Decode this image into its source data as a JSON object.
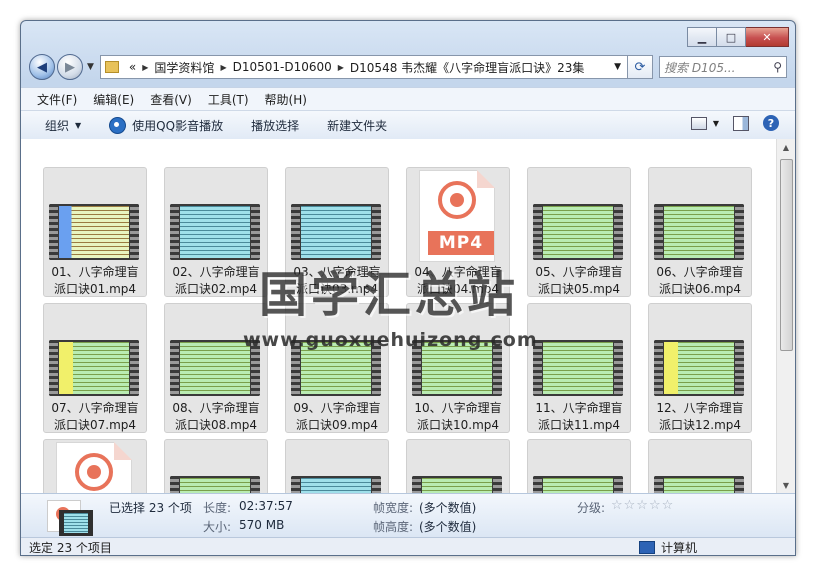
{
  "window": {
    "caption_min": "▁",
    "caption_max": "□",
    "caption_close": "✕"
  },
  "nav": {
    "back_glyph": "◀",
    "fwd_glyph": "▶",
    "overflow": "«",
    "breadcrumbs": [
      "国学资料馆",
      "D10501-D10600",
      "D10548 韦杰耀《八字命理盲派口诀》23集"
    ],
    "search_placeholder": "搜索 D105..."
  },
  "menu": [
    "文件(F)",
    "编辑(E)",
    "查看(V)",
    "工具(T)",
    "帮助(H)"
  ],
  "toolbar": {
    "organize": "组织",
    "play_qq": "使用QQ影音播放",
    "play_selection": "播放选择",
    "new_folder": "新建文件夹"
  },
  "files": [
    {
      "name": "01、八字命理盲派口诀01.mp4",
      "thumb": "mixed"
    },
    {
      "name": "02、八字命理盲派口诀02.mp4",
      "thumb": "teal"
    },
    {
      "name": "03、八字命理盲派口诀03.mp4",
      "thumb": "teal"
    },
    {
      "name": "04、八字命理盲派口诀04.mp4",
      "thumb": "doc"
    },
    {
      "name": "05、八字命理盲派口诀05.mp4",
      "thumb": "green"
    },
    {
      "name": "06、八字命理盲派口诀06.mp4",
      "thumb": "green"
    },
    {
      "name": "07、八字命理盲派口诀07.mp4",
      "thumb": "mixed2"
    },
    {
      "name": "08、八字命理盲派口诀08.mp4",
      "thumb": "green"
    },
    {
      "name": "09、八字命理盲派口诀09.mp4",
      "thumb": "green"
    },
    {
      "name": "10、八字命理盲派口诀10.mp4",
      "thumb": "green"
    },
    {
      "name": "11、八字命理盲派口诀11.mp4",
      "thumb": "green"
    },
    {
      "name": "12、八字命理盲派口诀12.mp4",
      "thumb": "mixed2"
    },
    {
      "name": "",
      "thumb": "doc"
    },
    {
      "name": "",
      "thumb": "green"
    },
    {
      "name": "",
      "thumb": "teal"
    },
    {
      "name": "",
      "thumb": "green"
    },
    {
      "name": "",
      "thumb": "green"
    },
    {
      "name": "",
      "thumb": "green"
    }
  ],
  "mp4_label": "MP4",
  "watermark": {
    "title": "国学汇总站",
    "url": "www.guoxuehuizong.com"
  },
  "details": {
    "selected": "已选择 23 个项",
    "length_label": "长度:",
    "length_value": "02:37:57",
    "size_label": "大小:",
    "size_value": "570 MB",
    "frame_width_label": "帧宽度:",
    "frame_width_value": "(多个数值)",
    "frame_height_label": "帧高度:",
    "frame_height_value": "(多个数值)",
    "rating_label": "分级:",
    "rating_stars": "☆☆☆☆☆"
  },
  "status": {
    "left": "选定 23 个项目",
    "right": "计算机"
  }
}
